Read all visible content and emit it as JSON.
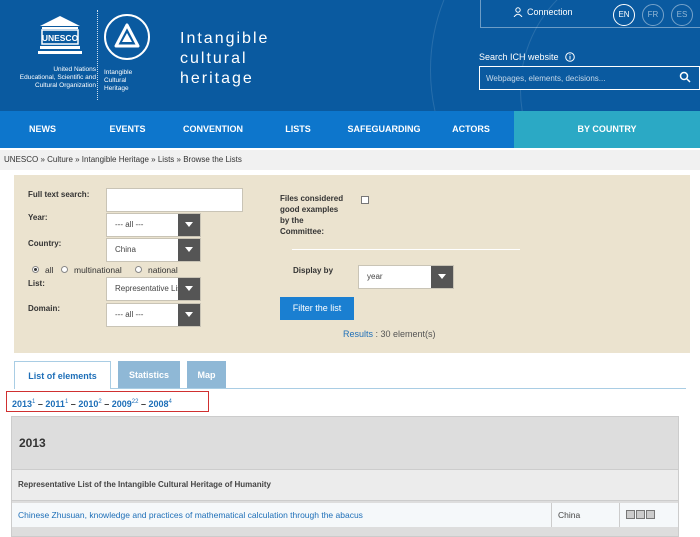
{
  "header": {
    "unesco_wordmark": "UNESCO",
    "org_line1": "United Nations",
    "org_line2": "Educational, Scientific and",
    "org_line3": "Cultural Organization",
    "ich_small_line1": "Intangible",
    "ich_small_line2": "Cultural",
    "ich_small_line3": "Heritage",
    "title_line1": "Intangible",
    "title_line2": "cultural",
    "title_line3": "heritage",
    "connection": "Connection",
    "languages": [
      "EN",
      "FR",
      "ES"
    ],
    "search_label": "Search ICH website",
    "search_placeholder": "Webpages, elements, decisions..."
  },
  "nav": {
    "items": [
      "NEWS",
      "EVENTS",
      "CONVENTION",
      "LISTS",
      "SAFEGUARDING",
      "ACTORS",
      "BY COUNTRY"
    ]
  },
  "breadcrumb": "UNESCO » Culture » Intangible Heritage » Lists » Browse the Lists",
  "filter": {
    "full_text_label": "Full text search:",
    "full_text_value": "",
    "year_label": "Year:",
    "year_value": "--- all ---",
    "country_label": "Country:",
    "country_value": "China",
    "radio_all": "all",
    "radio_multinational": "multinational",
    "radio_national": "national",
    "list_label": "List:",
    "list_value": "Representative List",
    "domain_label": "Domain:",
    "domain_value": "--- all ---",
    "good_examples_label_1": "Files considered",
    "good_examples_label_2": "good examples",
    "good_examples_label_3": "by the",
    "good_examples_label_4": "Committee:",
    "display_by_label": "Display by",
    "display_by_value": "year",
    "filter_button": "Filter the list",
    "results_link": "Results",
    "results_text": " : 30 element(s)"
  },
  "tabs": [
    "List of elements",
    "Statistics",
    "Map"
  ],
  "years": [
    {
      "year": "2013",
      "count": "1"
    },
    {
      "year": "2011",
      "count": "1"
    },
    {
      "year": "2010",
      "count": "2"
    },
    {
      "year": "2009",
      "count": "22"
    },
    {
      "year": "2008",
      "count": "4"
    }
  ],
  "results_table": {
    "year_heading": "2013",
    "list_heading": "Representative List of the Intangible Cultural Heritage of Humanity",
    "element_name": "Chinese Zhusuan, knowledge and practices of mathematical calculation through the abacus",
    "element_country": "China"
  },
  "colors": {
    "header_bg": "#0a5aa0",
    "nav_bg": "#0d76cc",
    "country_tab": "#2ba9c5",
    "filter_bg": "#ebe3cf",
    "link": "#1e6fb8",
    "highlight_box": "#d03030"
  }
}
